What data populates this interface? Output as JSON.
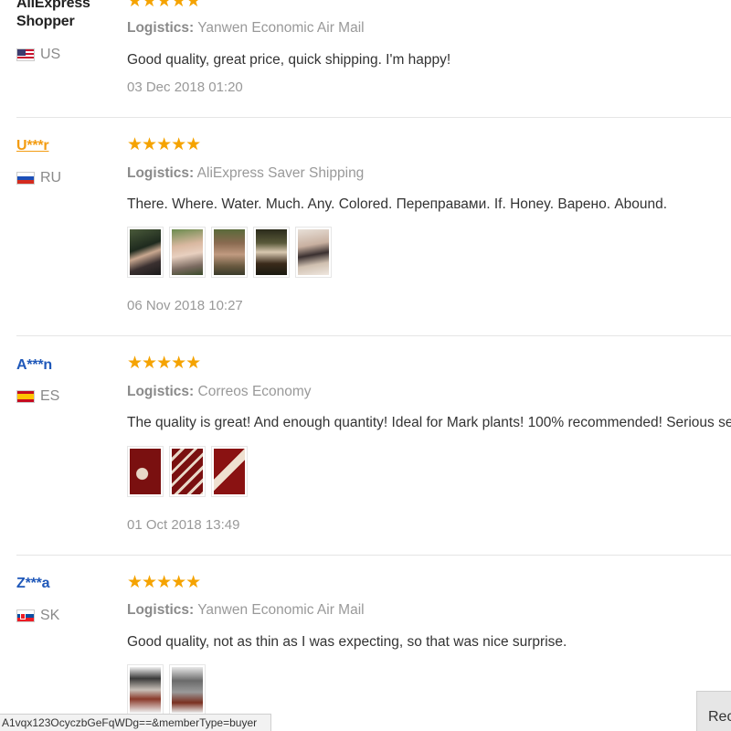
{
  "reviews": [
    {
      "user": "AliExpress Shopper",
      "user_line1": "AliExpress",
      "user_line2": "Shopper",
      "country": "US",
      "stars": "★★★★★",
      "logistics_label": "Logistics:",
      "logistics_value": "Yanwen Economic Air Mail",
      "comment": "Good quality, great price, quick shipping. I'm happy!",
      "date": "03 Dec 2018 01:20",
      "rating": 5,
      "photos": []
    },
    {
      "user": "U***r",
      "country": "RU",
      "stars": "★★★★★",
      "logistics_label": "Logistics:",
      "logistics_value": "AliExpress Saver Shipping",
      "comment": "There. Where. Water. Much. Any. Colored. Переправами. If. Honey. Варено. Abound.",
      "date": "06 Nov 2018 10:27",
      "rating": 5,
      "photos": [
        "photo-1",
        "photo-2",
        "photo-3",
        "photo-4",
        "photo-5"
      ]
    },
    {
      "user": "A***n",
      "country": "ES",
      "stars": "★★★★★",
      "logistics_label": "Logistics:",
      "logistics_value": "Correos Economy",
      "comment": "The quality is great! And enough quantity! Ideal for Mark plants! 100% recommended! Serious seller!",
      "date": "01 Oct 2018 13:49",
      "rating": 5,
      "photos": [
        "photo-1",
        "photo-2",
        "photo-3"
      ]
    },
    {
      "user": "Z***a",
      "country": "SK",
      "stars": "★★★★★",
      "logistics_label": "Logistics:",
      "logistics_value": "Yanwen Economic Air Mail",
      "comment": "Good quality, not as thin as I was expecting, so that was nice surprise.",
      "rating": 5,
      "photos": [
        "photo-1",
        "photo-2"
      ]
    }
  ],
  "status_bar": {
    "url": "A1vqx123OcyczbGeFqWDg==&memberType=buyer"
  },
  "recent_button": {
    "label": "Rece"
  },
  "colors": {
    "star": "#f5a300",
    "user_link": "#1f58b9",
    "user_visited": "#f39c12"
  }
}
